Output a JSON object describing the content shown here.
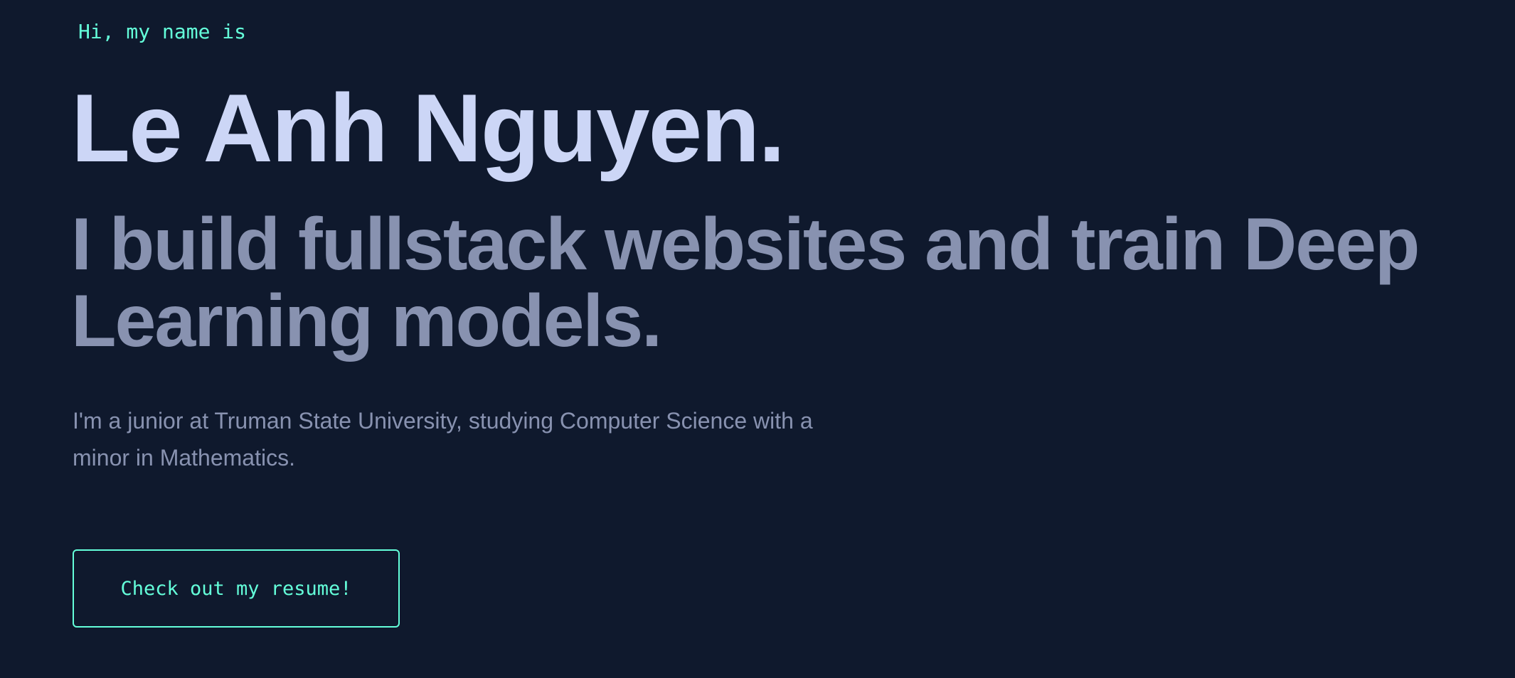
{
  "hero": {
    "greeting": "Hi, my name is",
    "name": "Le Anh Nguyen.",
    "tagline": "I build fullstack websites and train Deep Learning models.",
    "description": "I'm a junior at Truman State University, studying Computer Science with a minor in Mathematics.",
    "resume_button": "Check out my resume!"
  },
  "colors": {
    "background": "#0f192d",
    "accent": "#64ffda",
    "heading": "#ccd6f6",
    "muted": "#8892b0"
  }
}
